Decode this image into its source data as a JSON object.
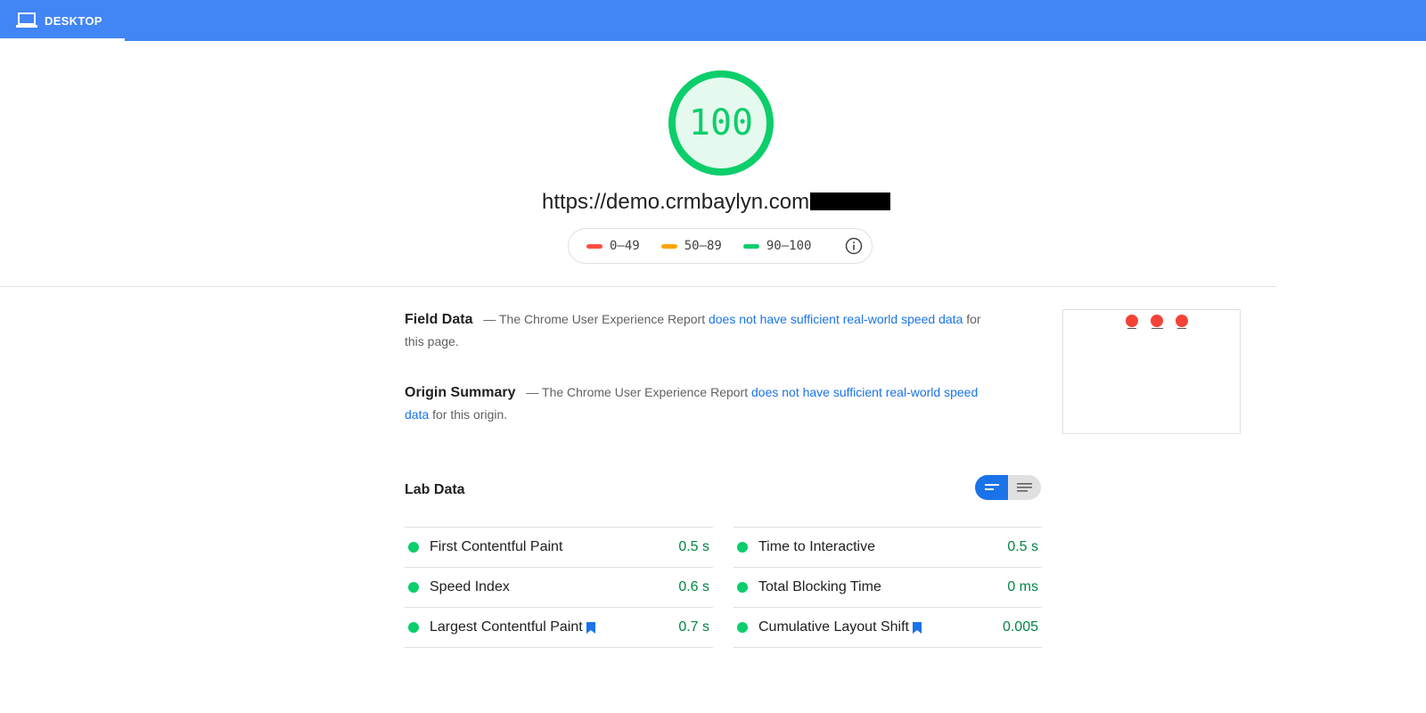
{
  "tab": {
    "label": "DESKTOP"
  },
  "score": {
    "value": "100"
  },
  "url": "https://demo.crmbaylyn.com",
  "legend": [
    {
      "range": "0–49",
      "color": "#ff4e42"
    },
    {
      "range": "50–89",
      "color": "#ffa400"
    },
    {
      "range": "90–100",
      "color": "#0cce6b"
    }
  ],
  "field_data": {
    "heading": "Field Data",
    "prefix": "— The Chrome User Experience Report ",
    "link": "does not have sufficient real-world speed data",
    "suffix": " for this page."
  },
  "origin_summary": {
    "heading": "Origin Summary",
    "prefix": "— The Chrome User Experience Report ",
    "link": "does not have sufficient real-world speed data",
    "suffix": " for this origin."
  },
  "lab_data": {
    "title": "Lab Data",
    "left": [
      {
        "name": "First Contentful Paint",
        "value": "0.5 s",
        "bookmark": false
      },
      {
        "name": "Speed Index",
        "value": "0.6 s",
        "bookmark": false
      },
      {
        "name": "Largest Contentful Paint",
        "value": "0.7 s",
        "bookmark": true
      }
    ],
    "right": [
      {
        "name": "Time to Interactive",
        "value": "0.5 s",
        "bookmark": false
      },
      {
        "name": "Total Blocking Time",
        "value": "0 ms",
        "bookmark": false
      },
      {
        "name": "Cumulative Layout Shift",
        "value": "0.005",
        "bookmark": true
      }
    ]
  },
  "colors": {
    "header": "#4285f4",
    "pass": "#0cce6b",
    "pass_text": "#018642",
    "link": "#1a73e8"
  }
}
